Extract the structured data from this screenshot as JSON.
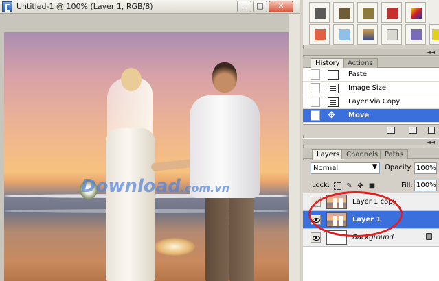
{
  "document": {
    "title": "Untitled-1 @ 100% (Layer 1, RGB/8)",
    "window_buttons": [
      "_",
      "□",
      "✕"
    ],
    "watermark": "Download",
    "watermark_suffix": ".com.vn"
  },
  "styles_panel": {
    "swatch_colors": [
      "#5a5a5a",
      "#6d5e35",
      "#8e7a3a",
      "#c83030",
      "#e8d020",
      "#e06040",
      "#8fc0e8",
      "#d09840",
      "#d8d8d0",
      "#7a6ab8",
      "#e0d020"
    ]
  },
  "history_panel": {
    "tabs": [
      "History",
      "Actions"
    ],
    "items": [
      {
        "label": "Paste",
        "icon": "document-icon"
      },
      {
        "label": "Image Size",
        "icon": "image-size-icon"
      },
      {
        "label": "Layer Via Copy",
        "icon": "document-icon"
      },
      {
        "label": "Move",
        "icon": "move-icon",
        "selected": true
      }
    ]
  },
  "layers_panel": {
    "tabs": [
      "Layers",
      "Channels",
      "Paths"
    ],
    "blend_mode": "Normal",
    "opacity_label": "Opacity:",
    "opacity_value": "100%",
    "lock_label": "Lock:",
    "fill_label": "Fill:",
    "fill_value": "100%",
    "layers": [
      {
        "name": "Layer 1 copy",
        "visible": false,
        "selected": false
      },
      {
        "name": "Layer 1",
        "visible": true,
        "selected": true
      },
      {
        "name": "Background",
        "visible": true,
        "selected": false,
        "locked": true
      }
    ]
  },
  "colors": {
    "selection": "#3a6fdc",
    "highlight_ring": "#e02020"
  }
}
